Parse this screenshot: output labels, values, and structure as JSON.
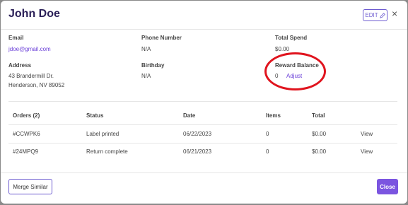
{
  "customer": {
    "name": "John Doe"
  },
  "header": {
    "edit_label": "EDIT"
  },
  "fields": {
    "email": {
      "label": "Email",
      "value": "jdoe@gmail.com"
    },
    "phone": {
      "label": "Phone Number",
      "value": "N/A"
    },
    "total_spend": {
      "label": "Total Spend",
      "value": "$0.00"
    },
    "address": {
      "label": "Address",
      "line1": "43 Brandermill Dr.",
      "line2": "Henderson, NV 89052"
    },
    "birthday": {
      "label": "Birthday",
      "value": "N/A"
    },
    "reward": {
      "label": "Reward Balance",
      "value": "0",
      "action": "Adjust"
    }
  },
  "orders": {
    "headers": [
      "Orders (2)",
      "Status",
      "Date",
      "Items",
      "Total"
    ],
    "rows": [
      {
        "id": "#CCWPK6",
        "status": "Label printed",
        "date": "06/22/2023",
        "items": "0",
        "total": "$0.00",
        "action": "View"
      },
      {
        "id": "#24MPQ9",
        "status": "Return complete",
        "date": "06/21/2023",
        "items": "0",
        "total": "$0.00",
        "action": "View"
      }
    ]
  },
  "footer": {
    "merge_label": "Merge Similar",
    "close_label": "Close"
  },
  "colors": {
    "accent": "#6d5bd0",
    "link": "#6a3fd8",
    "highlight": "#e0141e"
  }
}
